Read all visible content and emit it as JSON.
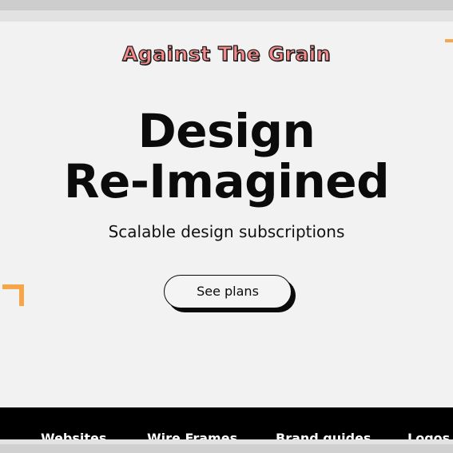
{
  "brand": {
    "name": "Against The Grain"
  },
  "hero": {
    "headline_line1": "Design",
    "headline_line2": "Re-Imagined",
    "subheadline": "Scalable design subscriptions",
    "cta_label": "See plans"
  },
  "nav": {
    "items": [
      "Websites",
      "Wire Frames",
      "Brand guides",
      "Logos"
    ]
  },
  "colors": {
    "brand_text": "#f58b8b",
    "accent_orange": "#f5a54a",
    "background": "#f2f2f2",
    "nav_background": "#000000"
  },
  "icons": {
    "left_decoration": "orange-corner-bracket-icon",
    "right_decoration": "orange-corner-bracket-icon"
  }
}
